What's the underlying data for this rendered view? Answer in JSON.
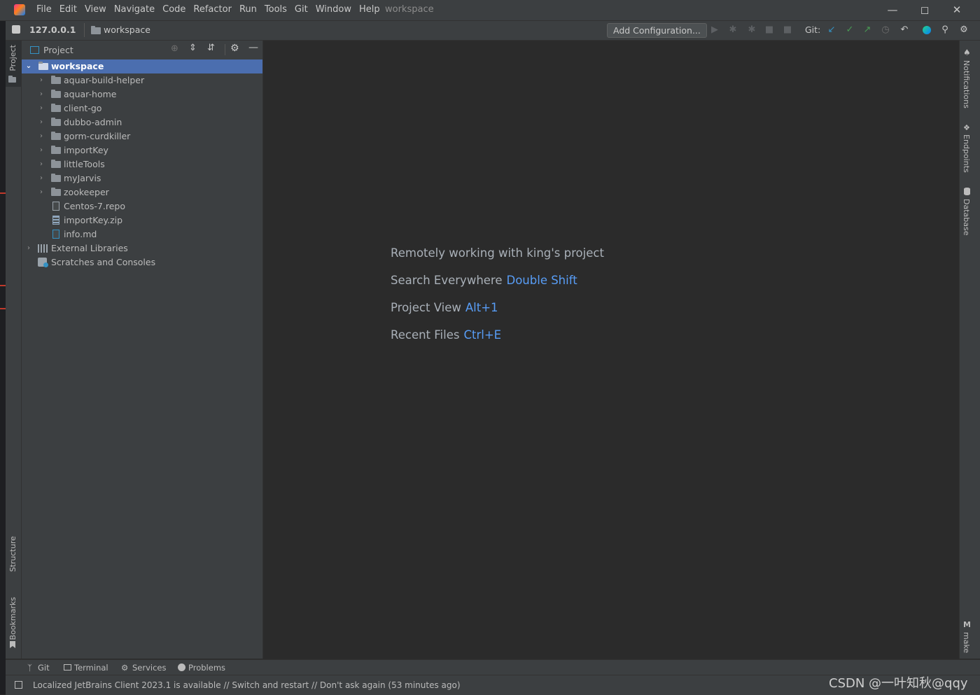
{
  "app": {
    "menu": [
      "File",
      "Edit",
      "View",
      "Navigate",
      "Code",
      "Refactor",
      "Run",
      "Tools",
      "Git",
      "Window",
      "Help"
    ],
    "window_title": "workspace"
  },
  "navbar": {
    "host": "127.0.0.1",
    "breadcrumb": "workspace",
    "add_configuration": "Add Configuration...",
    "git_label": "Git:"
  },
  "left_stripe": {
    "project": "Project",
    "structure": "Structure",
    "bookmarks": "Bookmarks"
  },
  "right_stripe": {
    "notifications": "Notifications",
    "endpoints": "Endpoints",
    "database": "Database",
    "make": "make"
  },
  "project_panel": {
    "title": "Project",
    "root": "workspace",
    "items": [
      {
        "label": "aquar-build-helper",
        "type": "folder"
      },
      {
        "label": "aquar-home",
        "type": "folder"
      },
      {
        "label": "client-go",
        "type": "folder"
      },
      {
        "label": "dubbo-admin",
        "type": "folder"
      },
      {
        "label": "gorm-curdkiller",
        "type": "folder"
      },
      {
        "label": "importKey",
        "type": "folder"
      },
      {
        "label": "littleTools",
        "type": "folder"
      },
      {
        "label": "myJarvis",
        "type": "folder"
      },
      {
        "label": "zookeeper",
        "type": "folder"
      },
      {
        "label": "Centos-7.repo",
        "type": "file"
      },
      {
        "label": "importKey.zip",
        "type": "archive"
      },
      {
        "label": "info.md",
        "type": "markdown"
      }
    ],
    "external_libraries": "External Libraries",
    "scratches": "Scratches and Consoles"
  },
  "editor_hints": {
    "remote": "Remotely working with king's project",
    "search_label": "Search Everywhere",
    "search_shortcut": "Double Shift",
    "project_view_label": "Project View",
    "project_view_shortcut": "Alt+1",
    "recent_files_label": "Recent Files",
    "recent_files_shortcut": "Ctrl+E"
  },
  "bottom_tools": {
    "git": "Git",
    "terminal": "Terminal",
    "services": "Services",
    "problems": "Problems"
  },
  "status": {
    "message": "Localized JetBrains Client 2023.1 is available // Switch and restart // Don't ask again (53 minutes ago)",
    "watermark": "CSDN @一叶知秋@qqy"
  },
  "colors": {
    "selection": "#4b6eaf",
    "shortcut": "#589df6",
    "panel_bg": "#3c3f41",
    "editor_bg": "#2b2b2b"
  }
}
